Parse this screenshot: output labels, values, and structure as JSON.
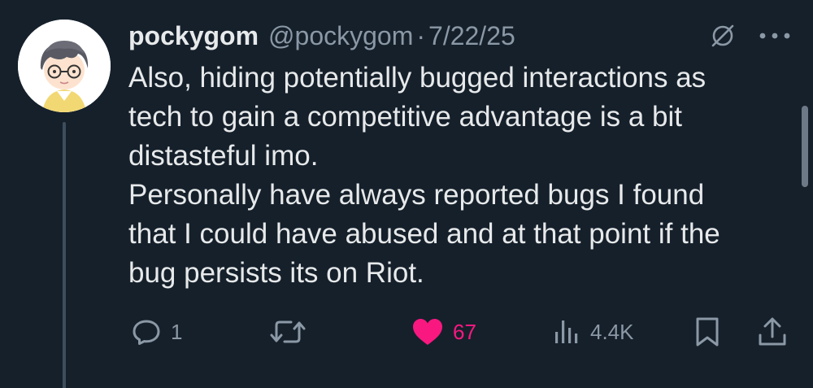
{
  "author": {
    "display_name": "pockygom",
    "handle": "@pockygom",
    "date": "7/22/25",
    "separator": "·"
  },
  "tweet": {
    "paragraphs": [
      "Also, hiding potentially bugged interactions as",
      "tech to gain a competitive advantage is a bit",
      "distasteful imo.",
      "Personally have always reported bugs I found",
      "that I could have abused and at that point if the",
      "bug persists its on Riot."
    ]
  },
  "actions": {
    "replies": "1",
    "retweets": "",
    "likes": "67",
    "views": "4.4K"
  },
  "icons": {
    "reply": "speech-bubble-icon",
    "retweet": "retweet-arrows-icon",
    "like": "heart-filled-icon",
    "views": "bar-chart-icon",
    "bookmark": "bookmark-icon",
    "share": "upload-icon",
    "grok": "grok-slash-icon",
    "more": "more-dots-icon"
  },
  "colors": {
    "background": "#15202b",
    "text": "#e7e9ea",
    "muted": "#8b98a5",
    "like": "#f91880"
  }
}
